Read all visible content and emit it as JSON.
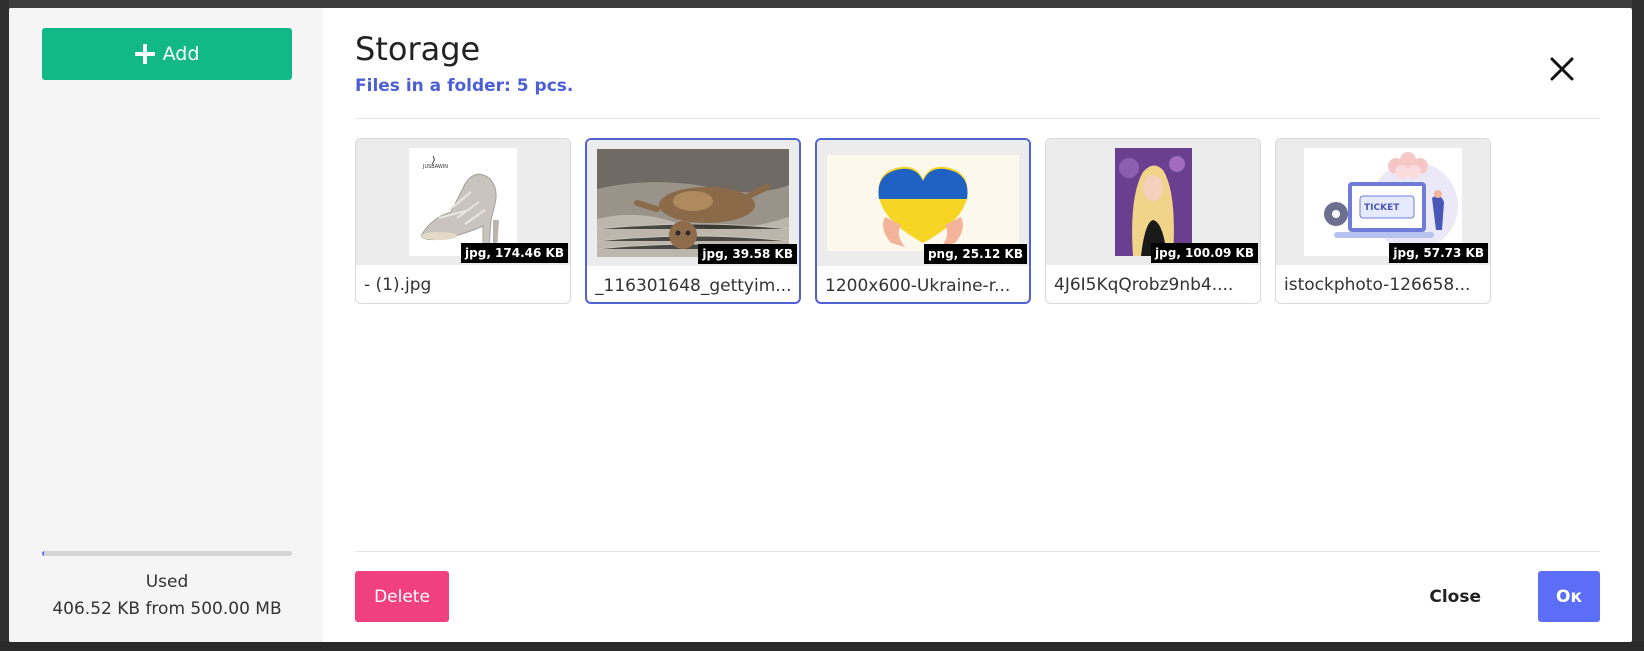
{
  "sidebar": {
    "add_label": "Add",
    "usage": {
      "label": "Used",
      "value_text": "406.52 KB from 500.00 MB",
      "used_fraction": 0.0008
    }
  },
  "header": {
    "title": "Storage",
    "subtitle": "Files in a folder: 5 pcs."
  },
  "files": [
    {
      "name": "- (1).jpg",
      "meta": "jpg, 174.46 KB",
      "selected": false,
      "icon": "shoe-image"
    },
    {
      "name": "_116301648_gettyim...",
      "meta": "jpg, 39.58 KB",
      "selected": true,
      "icon": "cat-image"
    },
    {
      "name": "1200x600-Ukraine-r...",
      "meta": "png, 25.12 KB",
      "selected": true,
      "icon": "heart-image"
    },
    {
      "name": "4J6I5KqQrobz9nb4....",
      "meta": "jpg, 100.09 KB",
      "selected": false,
      "icon": "portrait-image"
    },
    {
      "name": "istockphoto-126658...",
      "meta": "jpg, 57.73 KB",
      "selected": false,
      "icon": "ticket-image"
    }
  ],
  "ticket_text": "TICKET",
  "logo_text": "JUSBAWIN",
  "footer": {
    "delete_label": "Delete",
    "close_label": "Close",
    "ok_label": "Ок"
  },
  "colors": {
    "add": "#12b886",
    "accent": "#5b6ef5",
    "delete": "#f0407d",
    "subtitle": "#4c5fd5"
  }
}
